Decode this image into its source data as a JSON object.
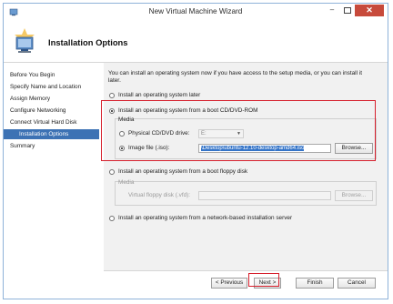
{
  "window": {
    "title": "New Virtual Machine Wizard",
    "close_glyph": "✕",
    "minimize_glyph": "–"
  },
  "header": {
    "title": "Installation Options"
  },
  "sidebar": {
    "items": [
      {
        "label": "Before You Begin"
      },
      {
        "label": "Specify Name and Location"
      },
      {
        "label": "Assign Memory"
      },
      {
        "label": "Configure Networking"
      },
      {
        "label": "Connect Virtual Hard Disk"
      },
      {
        "label": "Installation Options"
      },
      {
        "label": "Summary"
      }
    ]
  },
  "content": {
    "intro": "You can install an operating system now if you have access to the setup media, or you can install it later.",
    "options": {
      "later": "Install an operating system later",
      "boot_cd": "Install an operating system from a boot CD/DVD-ROM",
      "floppy": "Install an operating system from a boot floppy disk",
      "network": "Install an operating system from a network-based installation server"
    },
    "cd_group": {
      "title": "Media",
      "physical_label": "Physical CD/DVD drive:",
      "physical_value": "E:",
      "image_label": "Image file (.iso):",
      "image_value": "\\Desktop\\ubuntu-12.10-desktop-amd64.iso",
      "browse_label": "Browse..."
    },
    "floppy_group": {
      "title": "Media",
      "vfd_label": "Virtual floppy disk (.vfd):",
      "browse_label": "Browse..."
    }
  },
  "footer": {
    "previous": "< Previous",
    "next": "Next >",
    "finish": "Finish",
    "cancel": "Cancel"
  },
  "colors": {
    "accent": "#3c72b4",
    "highlight": "#d61f2c",
    "close": "#c74a3b"
  }
}
